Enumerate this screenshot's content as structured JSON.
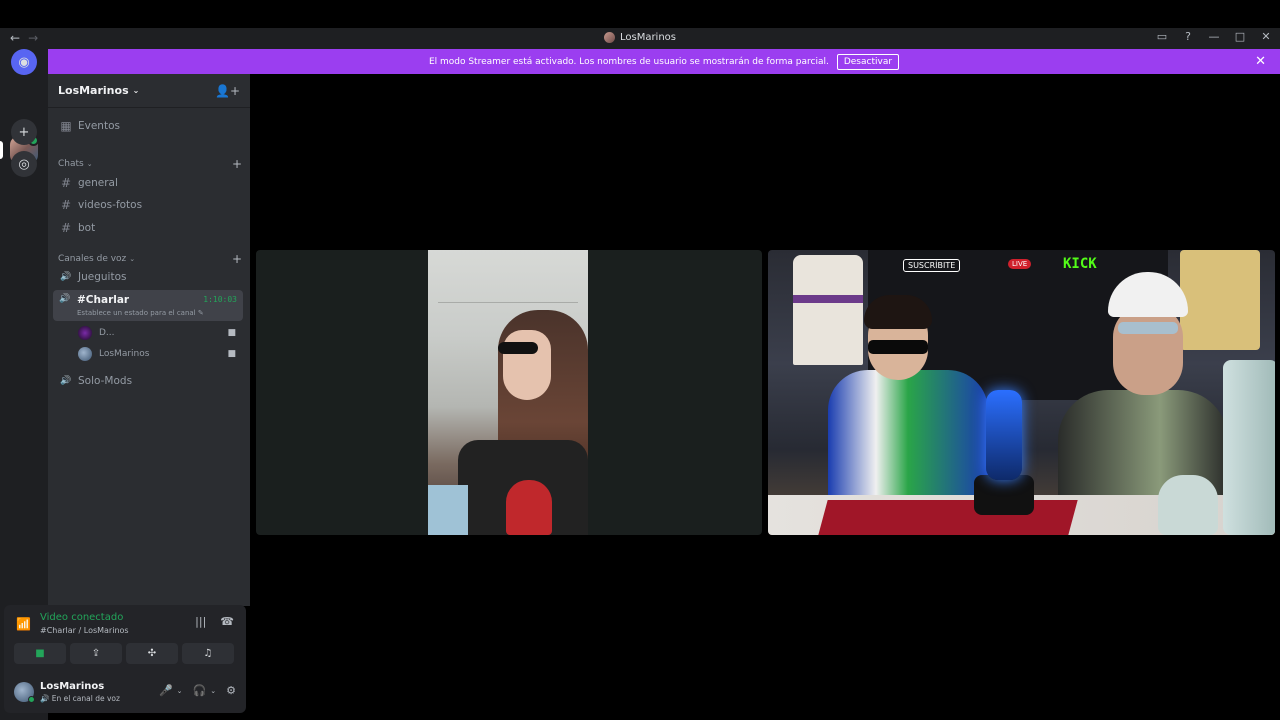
{
  "window": {
    "title": "LosMarinos",
    "back_glyph": "←",
    "forward_glyph": "→",
    "inbox_glyph": "▭",
    "help_glyph": "?",
    "minimize_glyph": "—",
    "maximize_glyph": "□",
    "close_glyph": "✕"
  },
  "banner": {
    "message": "El modo Streamer está activado. Los nombres de usuario se mostrarán de forma parcial.",
    "button_label": "Desactivar",
    "close_glyph": "✕"
  },
  "rail": {
    "home_glyph": "◉",
    "add_glyph": "+",
    "discover_glyph": "◎"
  },
  "server": {
    "name": "LosMarinos",
    "chevron": "⌄",
    "invite_glyph": "👤+"
  },
  "sidebar": {
    "events_label": "Eventos",
    "events_glyph": "▦",
    "chats_category": "Chats",
    "category_chevron": "⌄",
    "add_glyph": "+",
    "hash_glyph": "#",
    "speaker_glyph": "🔊",
    "text_channels": [
      "general",
      "videos-fotos",
      "bot"
    ],
    "voice_category": "Canales de voz",
    "voice_channels": {
      "first": "Jueguitos",
      "active": "#Charlar",
      "active_timer": "1:10:03",
      "active_status": "Establece un estado para el canal ✎",
      "last": "Solo-Mods"
    },
    "voice_users": [
      {
        "name": "D...",
        "camera_glyph": "■"
      },
      {
        "name": "LosMarinos",
        "camera_glyph": "■"
      }
    ]
  },
  "panel": {
    "signal_glyph": "📶",
    "status": "Video conectado",
    "location": "#Charlar / LosMarinos",
    "noise_glyph": "|||",
    "disconnect_glyph": "☎",
    "buttons": [
      {
        "name": "camera",
        "glyph": "■"
      },
      {
        "name": "screen-share",
        "glyph": "⇪"
      },
      {
        "name": "activities",
        "glyph": "✣"
      },
      {
        "name": "soundboard",
        "glyph": "♫"
      }
    ],
    "user": {
      "name": "LosMarinos",
      "subtitle": "🔊 En el canal de voz",
      "mic_glyph": "🎤",
      "headset_glyph": "🎧",
      "chevron": "⌄",
      "settings_glyph": "⚙"
    }
  },
  "stage": {
    "tile2_texts": {
      "kick": "KICK",
      "suscribite": "SUSCRÍBITE",
      "live": "LIVE"
    }
  },
  "colors": {
    "accent_purple": "#9b3ef0",
    "connected_green": "#23a55a",
    "sidebar_bg": "#2b2d31",
    "rail_bg": "#1e1f22"
  }
}
